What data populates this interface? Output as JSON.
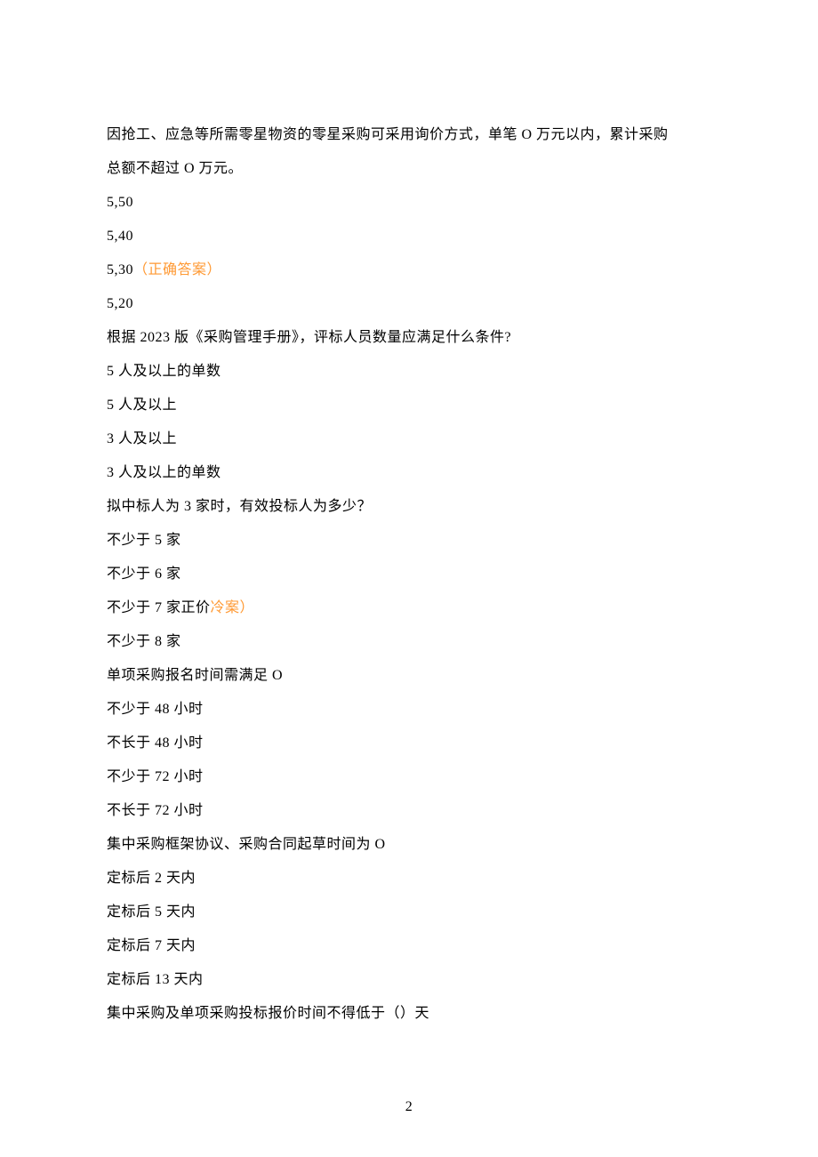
{
  "q1": {
    "line1": "因抢工、应急等所需零星物资的零星采购可采用询价方式，单笔 O 万元以内，累计采购",
    "line2": "总额不超过 O 万元。",
    "opt_a": "5,50",
    "opt_b": "5,40",
    "opt_c_text": "5,30",
    "opt_c_correct": "（正确答案）",
    "opt_d": "5,20"
  },
  "q2": {
    "prompt": "根据 2023 版《采购管理手册》，评标人员数量应满足什么条件?",
    "opt_a": "5 人及以上的单数",
    "opt_b": "5 人及以上",
    "opt_c": "3 人及以上",
    "opt_d": "3 人及以上的单数"
  },
  "q3": {
    "prompt": "拟中标人为 3 家时，有效投标人为多少？",
    "opt_a": "不少于 5 家",
    "opt_b": "不少于 6 家",
    "opt_c_text": "不少于 7 家正价",
    "opt_c_tail": "冷案）",
    "opt_d": "不少于 8 家"
  },
  "q4": {
    "prompt": "单项采购报名时间需满足 O",
    "opt_a": "不少于 48 小时",
    "opt_b": "不长于 48 小时",
    "opt_c": "不少于 72 小时",
    "opt_d": "不长于 72 小时"
  },
  "q5": {
    "prompt": "集中采购框架协议、采购合同起草时间为 O",
    "opt_a": "定标后 2 天内",
    "opt_b": "定标后 5 天内",
    "opt_c": "定标后 7 天内",
    "opt_d": "定标后 13 天内"
  },
  "q6": {
    "prompt": "集中采购及单项采购投标报价时间不得低于（）天"
  },
  "page_number": "2"
}
